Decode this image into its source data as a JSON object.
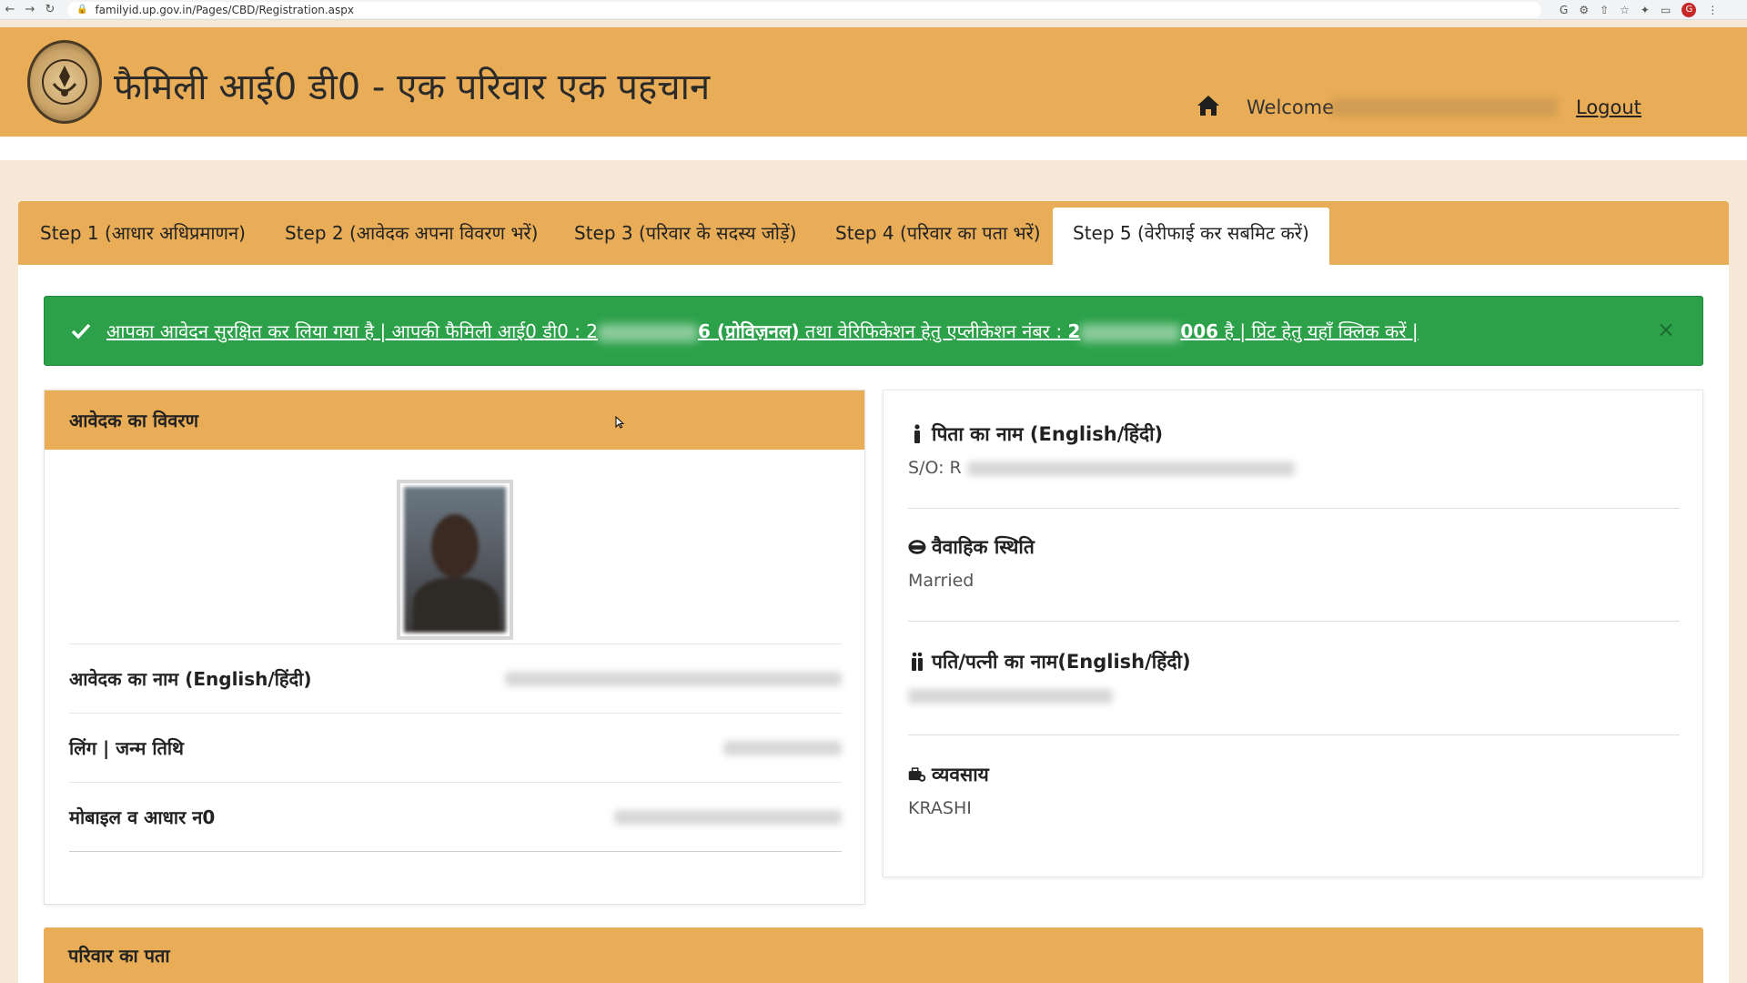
{
  "browser": {
    "url": "familyid.up.gov.in/Pages/CBD/Registration.aspx",
    "profile_initial": "G"
  },
  "header": {
    "title": "फैमिली आई0 डी0 - एक परिवार एक पहचान",
    "welcome_label": "Welcome",
    "logout_label": "Logout",
    "bg_color": "#e8ad56"
  },
  "tabs": [
    {
      "label": "Step 1 (आधार अधिप्रमाणन)",
      "active": false
    },
    {
      "label": "Step 2 (आवेदक अपना विवरण भरें)",
      "active": false
    },
    {
      "label": "Step 3 (परिवार के सदस्य जोड़ें)",
      "active": false
    },
    {
      "label": "Step 4 (परिवार का पता भरें)",
      "active": false
    },
    {
      "label": "Step 5 (वेरीफाई कर सबमिट करें)",
      "active": true
    }
  ],
  "alert": {
    "part1": "आपका आवेदन सुरक्षित कर लिया गया है | आपकी फैमिली आई0 डी0 : 2",
    "part2": "6 (प्रोविज़नल)",
    "part3": " तथा वेरिफिकेशन हेतु एप्लीकेशन नंबर : ",
    "part4": "2",
    "part5": "006",
    "part6": " है | प्रिंट हेतु यहाँ क्लिक करें |",
    "close_label": "×",
    "color": "#2ca14a"
  },
  "applicant_card": {
    "header": "आवेदक का विवरण",
    "rows": [
      {
        "label": "आवेदक का नाम (English/हिंदी)"
      },
      {
        "label": "लिंग | जन्म तिथि"
      },
      {
        "label": "मोबाइल व आधार न0"
      }
    ]
  },
  "info_card": {
    "father_title": "पिता का नाम (English/हिंदी)",
    "father_value": "S/O: R",
    "marital_title": "वैवाहिक स्थिति",
    "marital_value": "Married",
    "spouse_title": "पति/पत्नी का नाम(English/हिंदी)",
    "occupation_title": "व्यवसाय",
    "occupation_value": "KRASHI"
  },
  "address_card": {
    "header": "परिवार का पता"
  }
}
